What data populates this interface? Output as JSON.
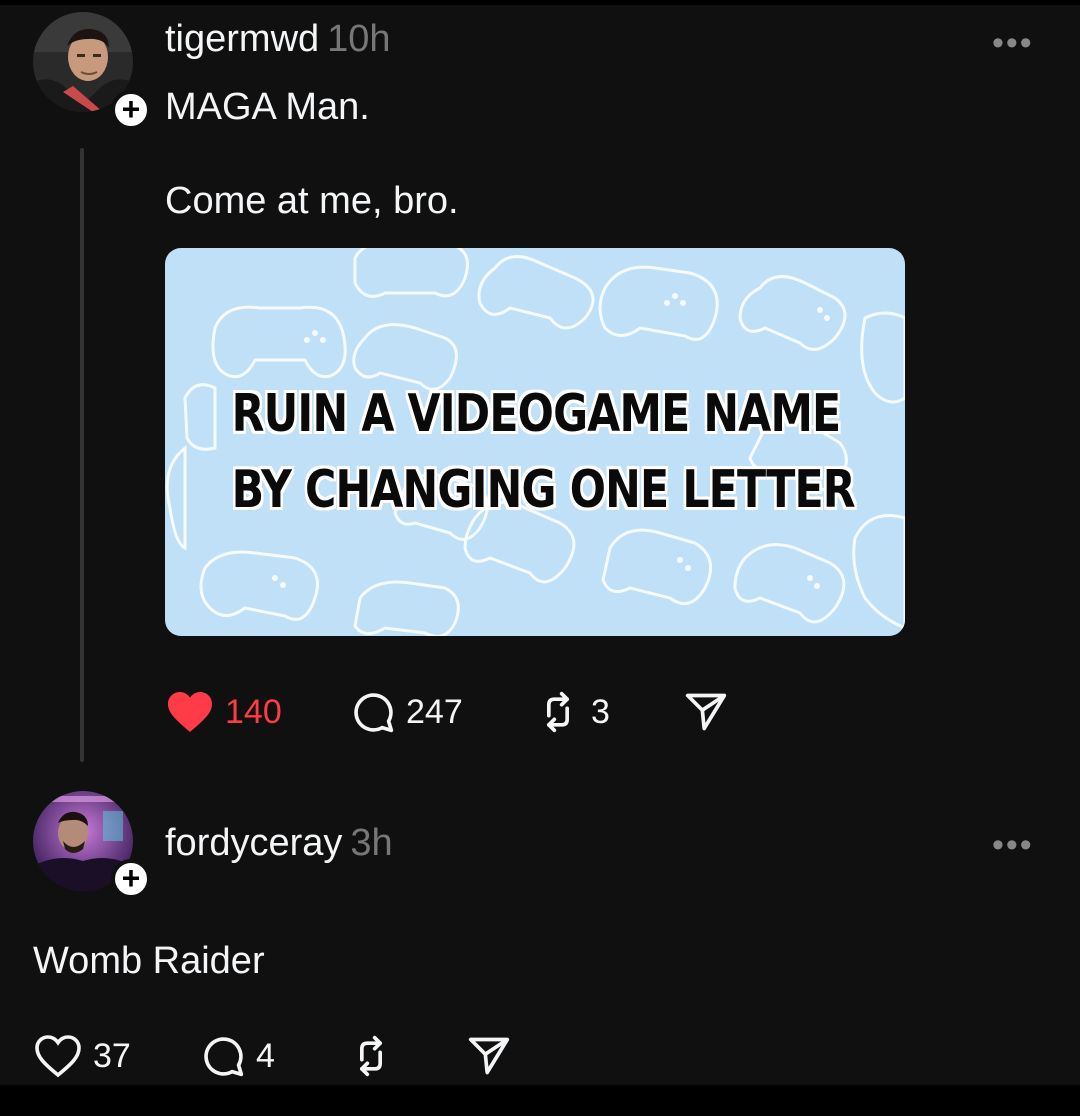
{
  "post": {
    "username": "tigermwd",
    "time": "10h",
    "more_label": "•••",
    "follow_label": "+",
    "text_line1": "MAGA Man.",
    "text_line2": "Come at me, bro.",
    "image_text_line1": "RUIN A VIDEOGAME NAME",
    "image_text_line2": "BY CHANGING ONE LETTER",
    "likes": "140",
    "liked": true,
    "replies": "247",
    "reposts": "3",
    "like_color": "#ff3b48",
    "image_bg_color": "#bfe0f6"
  },
  "reply": {
    "username": "fordyceray",
    "time": "3h",
    "more_label": "•••",
    "follow_label": "+",
    "text": "Womb Raider",
    "likes": "37",
    "replies": "4"
  },
  "icons": {
    "like": "heart-icon",
    "reply": "comment-icon",
    "repost": "repost-icon",
    "share": "send-icon",
    "more": "more-icon"
  }
}
